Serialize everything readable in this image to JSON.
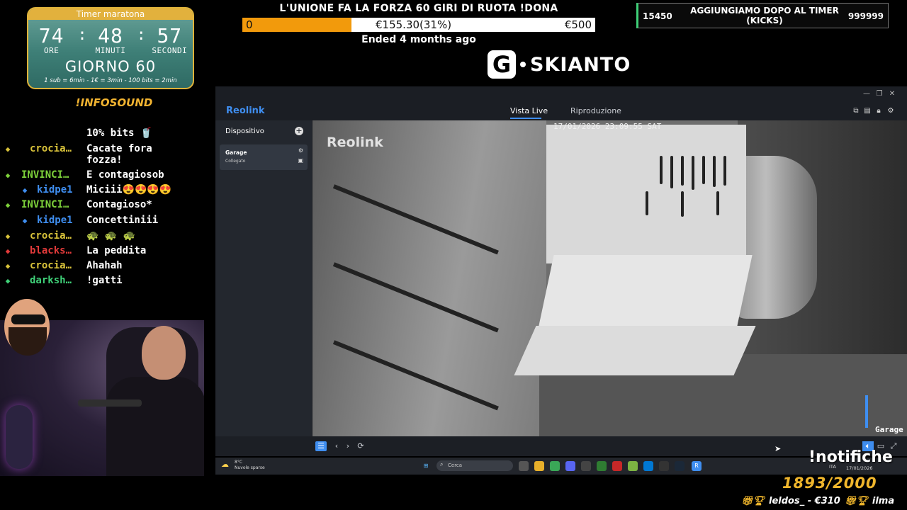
{
  "timer": {
    "title": "Timer maratona",
    "hours": "74",
    "minutes": "48",
    "seconds": "57",
    "hours_label": "ORE",
    "minutes_label": "MINUTI",
    "seconds_label": "SECONDI",
    "day": "GIORNO 60",
    "rules": "1 sub = 6min - 1€ = 3min - 100 bits = 2min"
  },
  "infosound": "!INFOSOUND",
  "chat": {
    "messages": [
      {
        "user": "",
        "text": "10% bits 🥤",
        "user_color": "#ffffff"
      },
      {
        "user": "crocia…",
        "text": "Cacate fora",
        "user_color": "#d8c23a"
      },
      {
        "user": "",
        "text": "fozza!",
        "user_color": "#ffffff"
      },
      {
        "user": "INVINCI…",
        "text": "E contagiosob",
        "user_color": "#7ed23b"
      },
      {
        "user": "kidpe1",
        "text": "Miciii😍😍😍😍",
        "user_color": "#3f8ef0"
      },
      {
        "user": "INVINCI…",
        "text": "Contagioso*",
        "user_color": "#7ed23b"
      },
      {
        "user": "kidpe1",
        "text": "Concettiniii",
        "user_color": "#3f8ef0"
      },
      {
        "user": "crocia…",
        "text": "🐢 🐢 🐢",
        "user_color": "#d8c23a"
      },
      {
        "user": "blacks…",
        "text": "La peddita",
        "user_color": "#e23a3a"
      },
      {
        "user": "crocia…",
        "text": "Ahahah",
        "user_color": "#d8c23a"
      },
      {
        "user": "darksh…",
        "text": "!gatti",
        "user_color": "#3fd178"
      }
    ]
  },
  "goal": {
    "title": "L'UNIONE FA LA FORZA 60 GIRI DI RUOTA !DONA",
    "start": "0",
    "current": "€155.30(31%)",
    "target": "€500",
    "progress": 0.31,
    "status": "Ended 4 months ago"
  },
  "logo": {
    "letter": "G",
    "word": "SKIANTO"
  },
  "kicks": {
    "left": "15450",
    "title": "AGGIUNGIAMO DOPO AL TIMER (KICKS)",
    "right": "999999"
  },
  "reolink": {
    "app_name": "Reolink",
    "tabs": {
      "live": "Vista Live",
      "playback": "Riproduzione"
    },
    "sidebar_title": "Dispositivo",
    "device": {
      "name": "Garage",
      "status": "Collegato"
    },
    "camera_logo": "Reolink",
    "timestamp": "17/01/2026 23:09:55 SAT",
    "camera_label": "Garage"
  },
  "taskbar": {
    "weather_temp": "8°C",
    "weather_desc": "Nuvole sparse",
    "search_placeholder": "Cerca",
    "lang": "ITA",
    "date": "17/01/2026"
  },
  "overlays": {
    "notifiche": "!notifiche",
    "sub_goal": "1893/2000",
    "ticker": [
      {
        "text": "leldos_ - €310"
      },
      {
        "text": "ilma"
      }
    ]
  },
  "colors": {
    "accent": "#3f8ef0",
    "gold": "#f0b62c",
    "goal_fill": "#f29a0c"
  }
}
